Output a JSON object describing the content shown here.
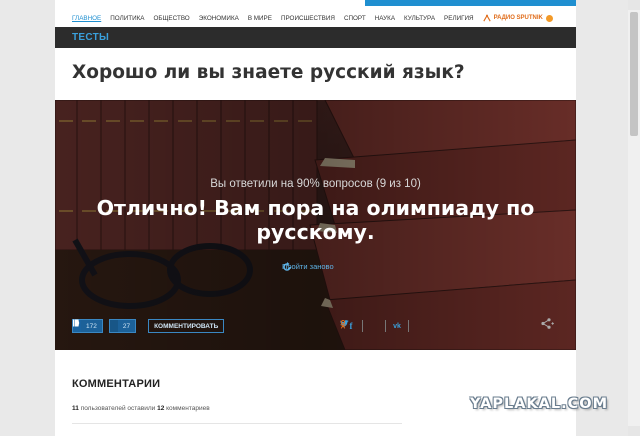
{
  "nav": {
    "items": [
      "ГЛАВНОЕ",
      "ПОЛИТИКА",
      "ОБЩЕСТВО",
      "ЭКОНОМИКА",
      "В МИРЕ",
      "ПРОИСШЕСТВИЯ",
      "СПОРТ",
      "НАУКА",
      "КУЛЬТУРА",
      "РЕЛИГИЯ"
    ],
    "active_index": 0,
    "radio_label": "РАДИО SPUTNIK"
  },
  "section": {
    "label": "ТЕСТЫ"
  },
  "article": {
    "title": "Хорошо ли вы знаете русский язык?"
  },
  "result": {
    "score_text": "Вы ответили на 90% вопросов (9 из 10)",
    "verdict": "Отлично! Вам пора на олимпиаду по русскому.",
    "retry_label": "Пройти заново"
  },
  "actions": {
    "likes": "172",
    "dislikes": "27",
    "comment_label": "КОММЕНТИРОВАТЬ"
  },
  "share_icons": [
    "facebook-icon",
    "twitter-icon",
    "vk-icon",
    "odnoklassniki-icon"
  ],
  "comments": {
    "heading": "КОММЕНТАРИИ",
    "users_count": "11",
    "users_text": "пользователей оставили",
    "comments_count": "12",
    "comments_text": "комментариев"
  },
  "watermark": "YAPLAKAL.COM",
  "colors": {
    "accent": "#1f8fd0",
    "section_bar": "#2c2c2c",
    "radio": "#e06c1a"
  }
}
